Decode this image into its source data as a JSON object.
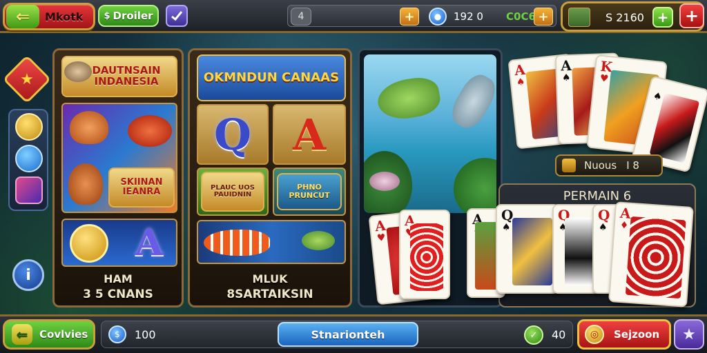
{
  "top_bar": {
    "back_label": "Mkotk",
    "dealer_label": "Droiler",
    "status_left": "4",
    "coins": "192 0",
    "gems": "C0C6",
    "balance": "S 2160"
  },
  "tiles": {
    "tile1": {
      "banner": "DAUTNSAIN INDANESIA",
      "art_banner": "SKIINAN IEANRA",
      "letter": "A",
      "caption_line1": "HAM",
      "caption_line2": "3 5 CNANS"
    },
    "tile2": {
      "banner": "OKMNDUN CANAAS",
      "letter_q": "Q",
      "letter_a": "A",
      "mini_banner_left": "PLAUC UOS PAUIDNIN",
      "mini_banner_right": "PHNO PRUNCUT",
      "caption_line1": "MLUK",
      "caption_line2": "8SARTAIKSIN"
    }
  },
  "cards": {
    "top_fan": [
      {
        "rank": "A",
        "suit": "♠",
        "color": "red"
      },
      {
        "rank": "A",
        "suit": "♠",
        "color": "black"
      },
      {
        "rank": "K",
        "suit": "♥",
        "color": "red"
      },
      {
        "rank": "",
        "suit": "♠",
        "color": "black"
      }
    ],
    "name_plate": "Nuous",
    "name_plate_value": "I 8",
    "table_title": "PERMAIN 6",
    "left_pair": [
      {
        "rank": "A",
        "suit": "♥",
        "color": "red"
      },
      {
        "rank": "A",
        "suit": "♥",
        "color": "red"
      }
    ],
    "table_fan": [
      {
        "rank": "A",
        "suit": "♦",
        "color": "black"
      },
      {
        "rank": "Q",
        "suit": "♠",
        "color": "black"
      },
      {
        "rank": "Q",
        "suit": "♠",
        "color": "red"
      },
      {
        "rank": "Q",
        "suit": "♠",
        "color": "red"
      },
      {
        "rank": "A",
        "suit": "♦",
        "color": "red"
      }
    ]
  },
  "bottom_bar": {
    "goods_label": "Covlvies",
    "left_value": "100",
    "start_label": "Stnarionteh",
    "right_value": "40",
    "redeem_label": "Sejzoon"
  },
  "icons": {
    "back": "arrow-left-icon",
    "info": "info-icon",
    "star": "star-icon"
  },
  "colors": {
    "gold_frame": "#c9a13c",
    "green_button": "#3f9a14",
    "red_button": "#c81a1a",
    "blue_button": "#1a64c0"
  }
}
